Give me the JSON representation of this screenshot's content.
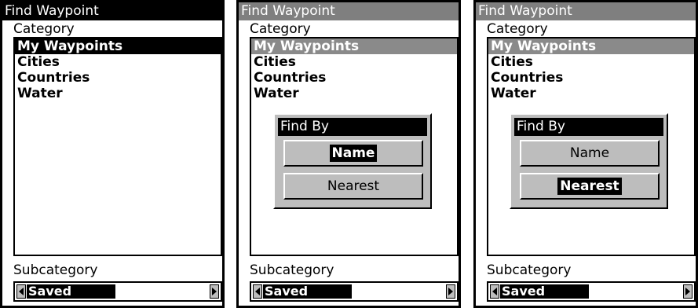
{
  "screens": [
    {
      "title": "Find Waypoint",
      "category_label": "Category",
      "categories": [
        "My Waypoints",
        "Cities",
        "Countries",
        "Water"
      ],
      "subcategory_label": "Subcategory",
      "subcategory_value": "Saved"
    },
    {
      "title": "Find Waypoint",
      "category_label": "Category",
      "categories": [
        "My Waypoints",
        "Cities",
        "Countries",
        "Water"
      ],
      "subcategory_label": "Subcategory",
      "subcategory_value": "Saved",
      "popup": {
        "title": "Find By",
        "buttons": [
          "Name",
          "Nearest"
        ]
      }
    },
    {
      "title": "Find Waypoint",
      "category_label": "Category",
      "categories": [
        "My Waypoints",
        "Cities",
        "Countries",
        "Water"
      ],
      "subcategory_label": "Subcategory",
      "subcategory_value": "Saved",
      "popup": {
        "title": "Find By",
        "buttons": [
          "Name",
          "Nearest"
        ]
      }
    }
  ],
  "colors": {
    "title_active": "#000000",
    "title_inactive": "#7f7f7f",
    "popup_face": "#bdbdbd",
    "selection_inactive": "#8a8a8a"
  },
  "icons": [
    "left-arrow-icon",
    "right-arrow-icon"
  ]
}
